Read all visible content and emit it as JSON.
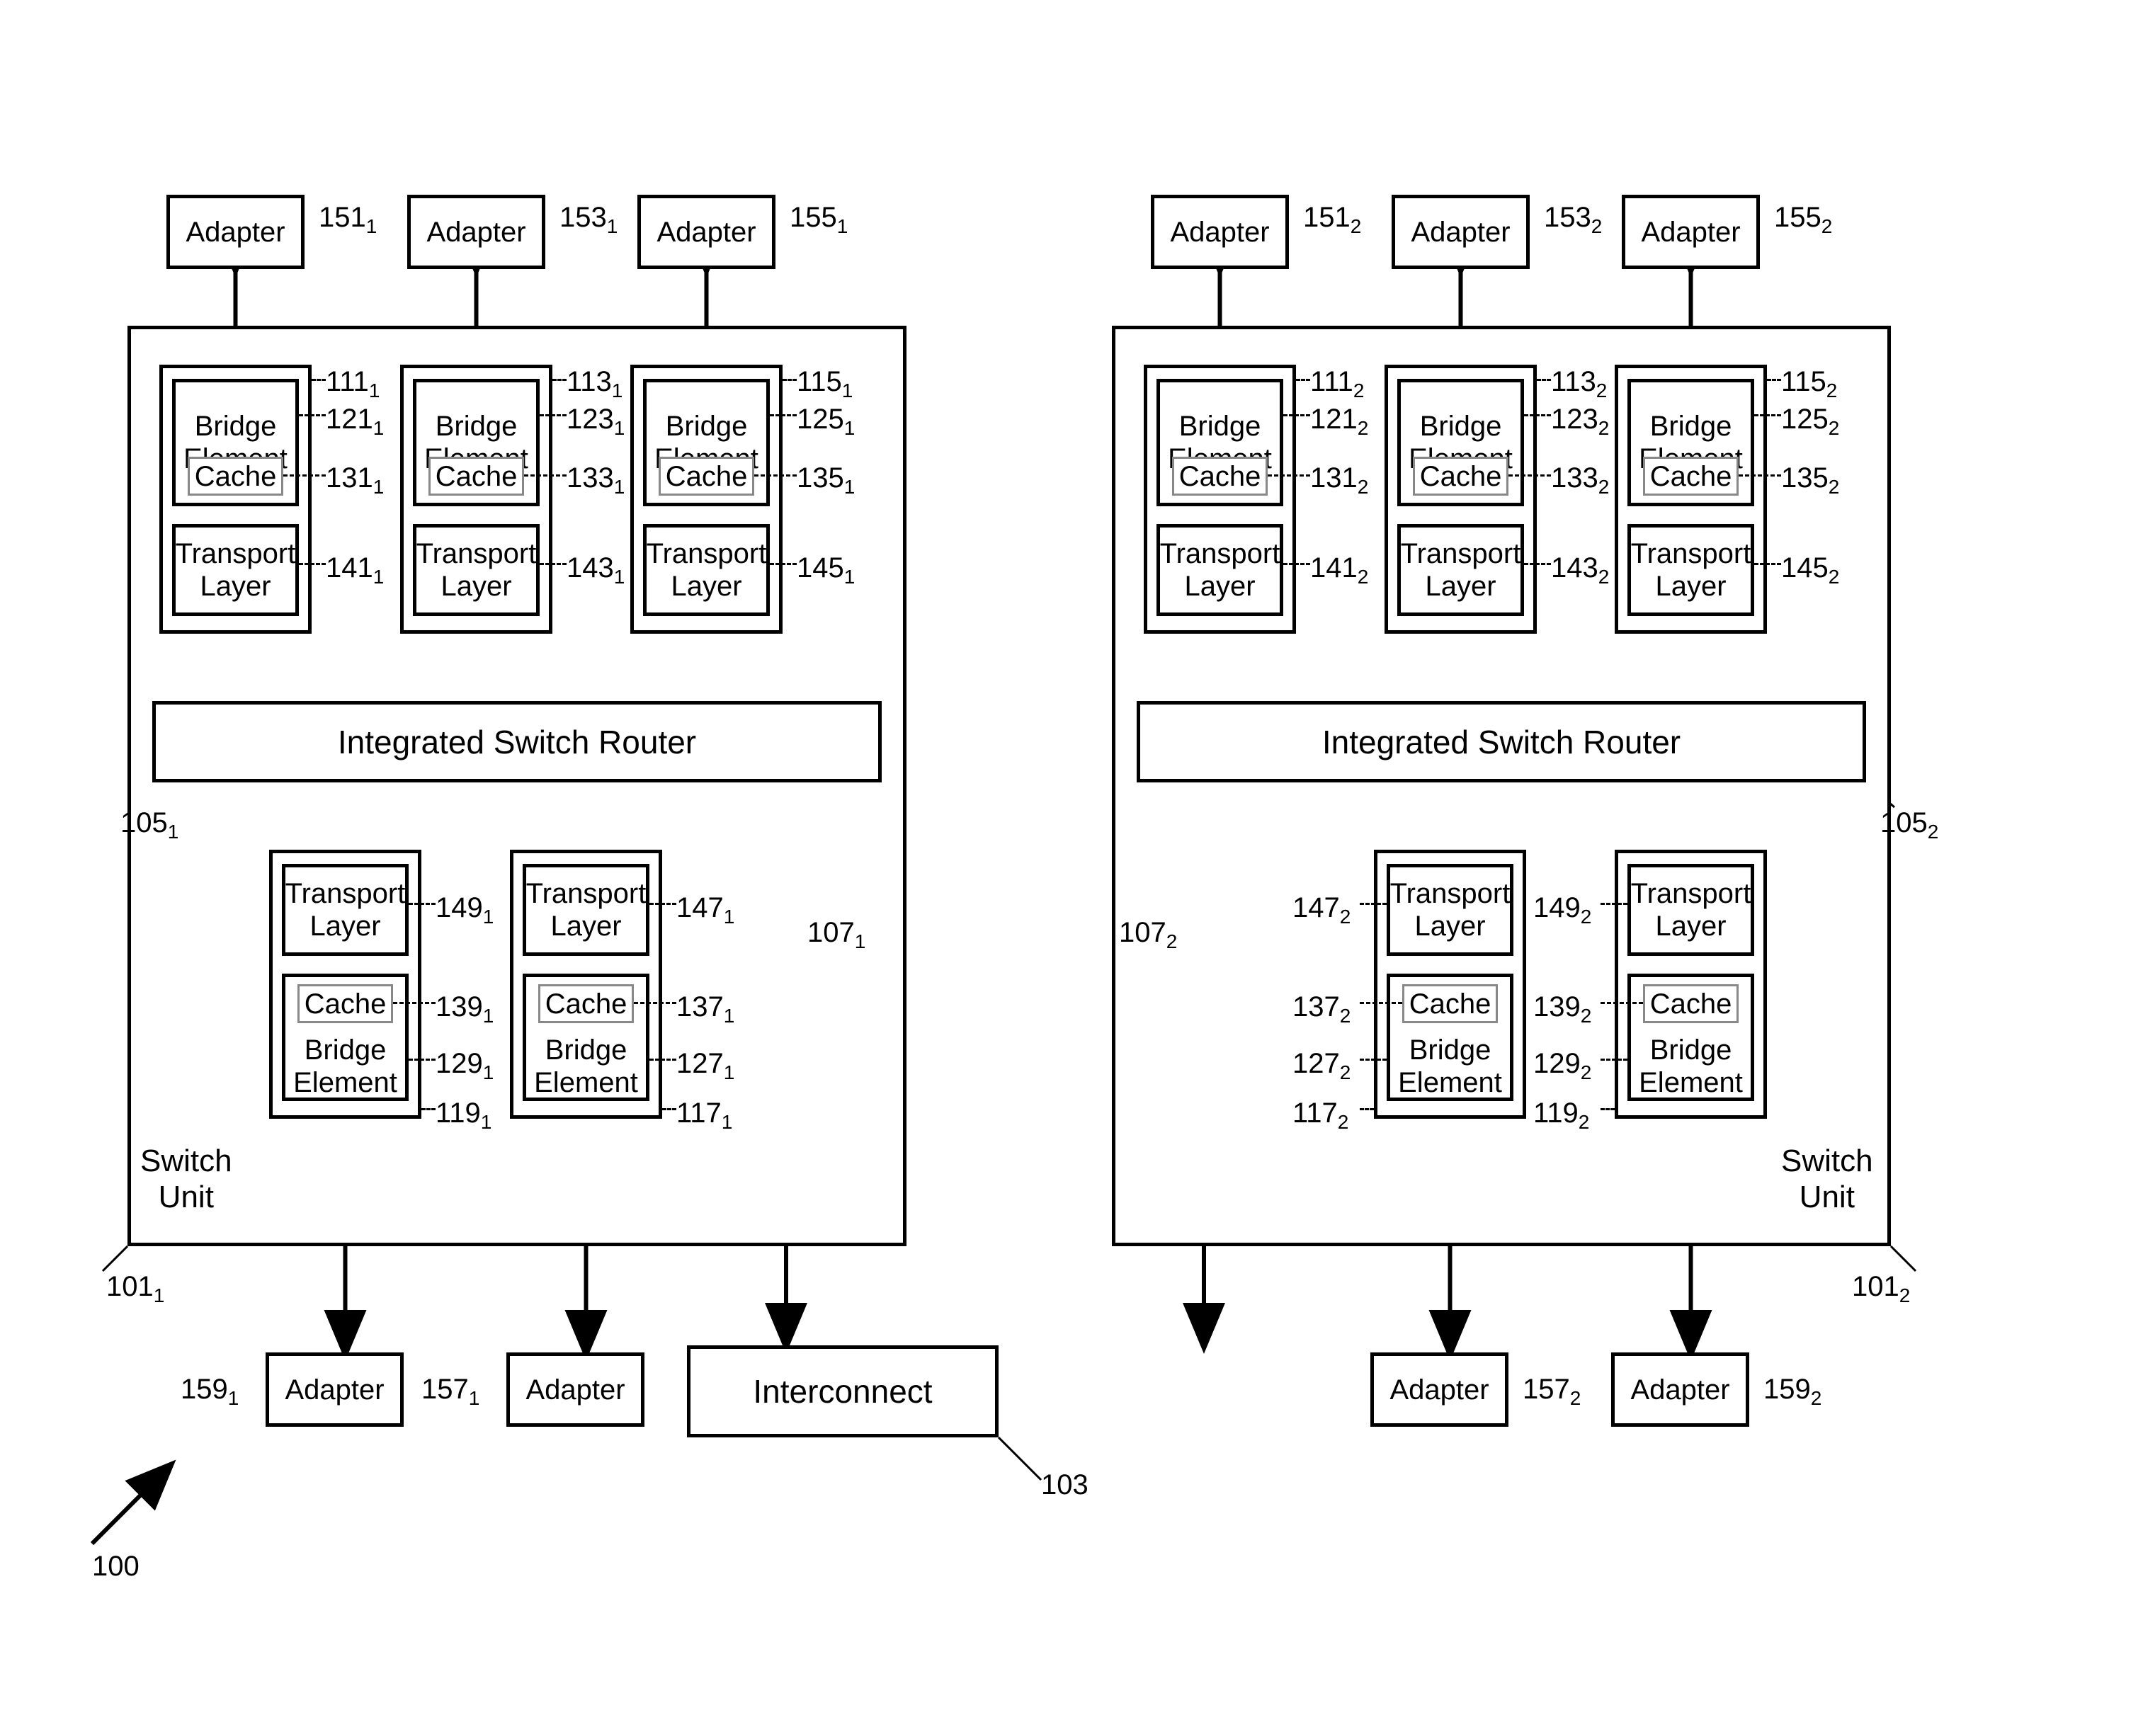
{
  "figureRef": "100",
  "interconnect": {
    "label": "Interconnect",
    "ref": "103"
  },
  "switchUnits": {
    "label": "Switch\nUnit",
    "left": {
      "ref": "101",
      "sub": "1",
      "isrRef": "105",
      "isrSub": "1",
      "icRef": "107",
      "icSub": "1"
    },
    "right": {
      "ref": "101",
      "sub": "2",
      "isrRef": "105",
      "isrSub": "2",
      "icRef": "107",
      "icSub": "2"
    }
  },
  "isr": {
    "label": "Integrated Switch Router"
  },
  "adapter": {
    "label": "Adapter"
  },
  "bridge": {
    "label": "Bridge\nElement"
  },
  "cache": {
    "label": "Cache"
  },
  "transport": {
    "label": "Transport\nLayer"
  },
  "topAdapters": {
    "left": [
      {
        "ref": "151",
        "sub": "1"
      },
      {
        "ref": "153",
        "sub": "1"
      },
      {
        "ref": "155",
        "sub": "1"
      }
    ],
    "right": [
      {
        "ref": "151",
        "sub": "2"
      },
      {
        "ref": "153",
        "sub": "2"
      },
      {
        "ref": "155",
        "sub": "2"
      }
    ]
  },
  "bottomAdapters": {
    "left": [
      {
        "ref": "159",
        "sub": "1"
      },
      {
        "ref": "157",
        "sub": "1"
      }
    ],
    "right": [
      {
        "ref": "157",
        "sub": "2"
      },
      {
        "ref": "159",
        "sub": "2"
      }
    ]
  },
  "topModules": {
    "left": [
      {
        "outer": {
          "ref": "111",
          "sub": "1"
        },
        "bridge": {
          "ref": "121",
          "sub": "1"
        },
        "cache": {
          "ref": "131",
          "sub": "1"
        },
        "transport": {
          "ref": "141",
          "sub": "1"
        }
      },
      {
        "outer": {
          "ref": "113",
          "sub": "1"
        },
        "bridge": {
          "ref": "123",
          "sub": "1"
        },
        "cache": {
          "ref": "133",
          "sub": "1"
        },
        "transport": {
          "ref": "143",
          "sub": "1"
        }
      },
      {
        "outer": {
          "ref": "115",
          "sub": "1"
        },
        "bridge": {
          "ref": "125",
          "sub": "1"
        },
        "cache": {
          "ref": "135",
          "sub": "1"
        },
        "transport": {
          "ref": "145",
          "sub": "1"
        }
      }
    ],
    "right": [
      {
        "outer": {
          "ref": "111",
          "sub": "2"
        },
        "bridge": {
          "ref": "121",
          "sub": "2"
        },
        "cache": {
          "ref": "131",
          "sub": "2"
        },
        "transport": {
          "ref": "141",
          "sub": "2"
        }
      },
      {
        "outer": {
          "ref": "113",
          "sub": "2"
        },
        "bridge": {
          "ref": "123",
          "sub": "2"
        },
        "cache": {
          "ref": "133",
          "sub": "2"
        },
        "transport": {
          "ref": "143",
          "sub": "2"
        }
      },
      {
        "outer": {
          "ref": "115",
          "sub": "2"
        },
        "bridge": {
          "ref": "125",
          "sub": "2"
        },
        "cache": {
          "ref": "135",
          "sub": "2"
        },
        "transport": {
          "ref": "145",
          "sub": "2"
        }
      }
    ]
  },
  "bottomModules": {
    "left": [
      {
        "outer": {
          "ref": "119",
          "sub": "1"
        },
        "bridge": {
          "ref": "129",
          "sub": "1"
        },
        "cache": {
          "ref": "139",
          "sub": "1"
        },
        "transport": {
          "ref": "149",
          "sub": "1"
        }
      },
      {
        "outer": {
          "ref": "117",
          "sub": "1"
        },
        "bridge": {
          "ref": "127",
          "sub": "1"
        },
        "cache": {
          "ref": "137",
          "sub": "1"
        },
        "transport": {
          "ref": "147",
          "sub": "1"
        }
      }
    ],
    "right": [
      {
        "outer": {
          "ref": "117",
          "sub": "2"
        },
        "bridge": {
          "ref": "127",
          "sub": "2"
        },
        "cache": {
          "ref": "137",
          "sub": "2"
        },
        "transport": {
          "ref": "147",
          "sub": "2"
        }
      },
      {
        "outer": {
          "ref": "119",
          "sub": "2"
        },
        "bridge": {
          "ref": "129",
          "sub": "2"
        },
        "cache": {
          "ref": "139",
          "sub": "2"
        },
        "transport": {
          "ref": "149",
          "sub": "2"
        }
      }
    ]
  }
}
